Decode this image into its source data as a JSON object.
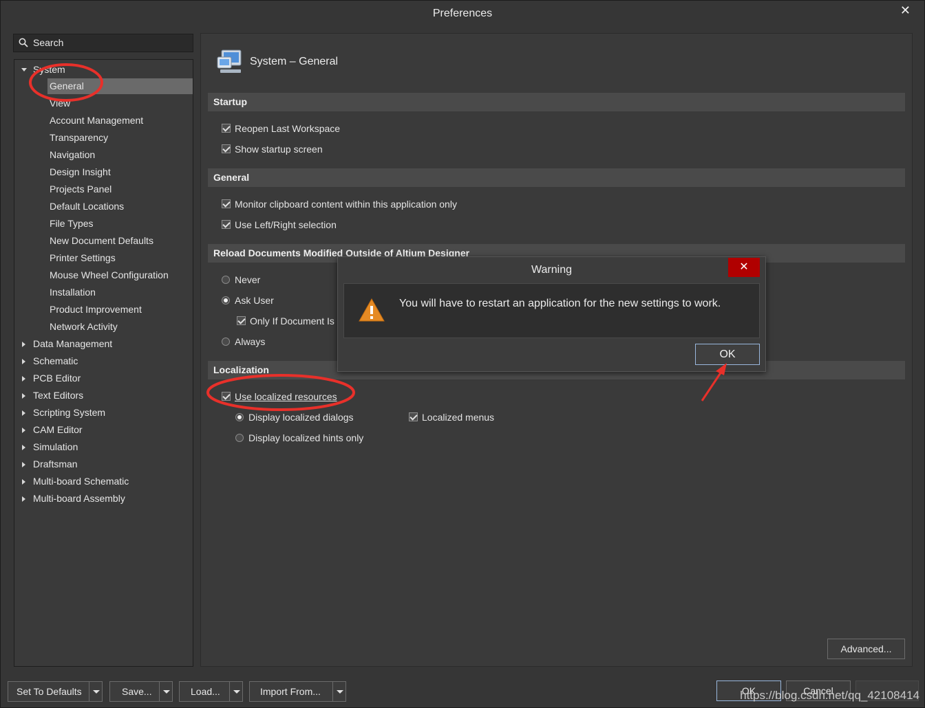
{
  "window": {
    "title": "Preferences"
  },
  "search": {
    "label": "Search"
  },
  "tree": {
    "system": "System",
    "system_children": [
      "General",
      "View",
      "Account Management",
      "Transparency",
      "Navigation",
      "Design Insight",
      "Projects Panel",
      "Default Locations",
      "File Types",
      "New Document Defaults",
      "Printer Settings",
      "Mouse Wheel Configuration",
      "Installation",
      "Product Improvement",
      "Network Activity"
    ],
    "top_level": [
      "Data Management",
      "Schematic",
      "PCB Editor",
      "Text Editors",
      "Scripting System",
      "CAM Editor",
      "Simulation",
      "Draftsman",
      "Multi-board Schematic",
      "Multi-board Assembly"
    ]
  },
  "page": {
    "title": "System – General",
    "startup": {
      "header": "Startup",
      "reopen": "Reopen Last Workspace",
      "show_startup": "Show startup screen"
    },
    "general": {
      "header": "General",
      "monitor_clipboard": "Monitor clipboard content within this application only",
      "left_right": "Use Left/Right selection"
    },
    "reload": {
      "header": "Reload Documents Modified Outside of Altium Designer",
      "never": "Never",
      "ask_user": "Ask User",
      "only_if": "Only If Document Is M",
      "always": "Always"
    },
    "localization": {
      "header": "Localization",
      "use_localized": "Use localized resources",
      "display_dialogs": "Display localized dialogs",
      "display_hints": "Display localized hints only",
      "localized_menus": "Localized menus"
    },
    "advanced": "Advanced..."
  },
  "footer": {
    "set_defaults": "Set To Defaults",
    "save": "Save...",
    "load": "Load...",
    "import_from": "Import From...",
    "ok": "OK",
    "cancel": "Cancel"
  },
  "dialog": {
    "title": "Warning",
    "close": "✕",
    "message": "You will have to restart an application for the new settings to work.",
    "ok": "OK"
  },
  "watermark": "https://blog.csdn.net/qq_42108414",
  "colors": {
    "annotation_red": "#e8302a",
    "dialog_close_bg": "#b00000",
    "ok_border": "#9ab8de"
  }
}
